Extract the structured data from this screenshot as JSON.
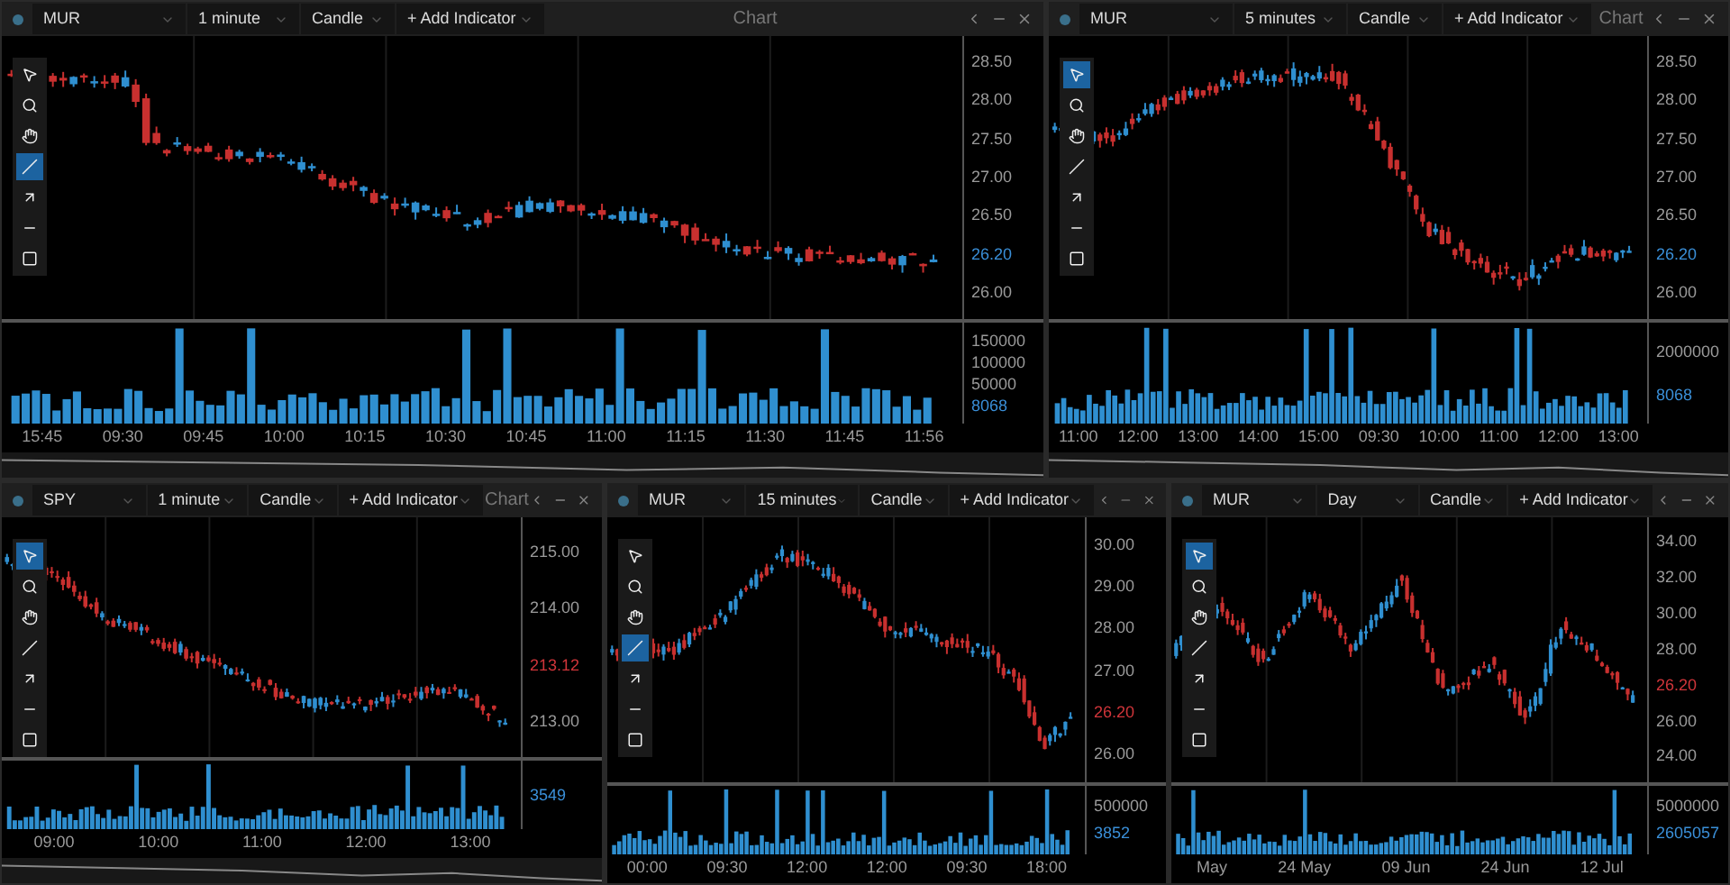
{
  "panels": [
    {
      "symbol": "MUR",
      "interval": "1 minute",
      "chart_type": "Candle",
      "add_indicator": "+ Add Indicator",
      "title": "Chart",
      "tools": [
        {
          "kind": "pointer",
          "selected": false
        },
        {
          "kind": "zoom",
          "selected": false
        },
        {
          "kind": "pan",
          "selected": false
        },
        {
          "kind": "line",
          "selected": true
        },
        {
          "kind": "arrow",
          "selected": false
        },
        {
          "kind": "hline",
          "selected": false
        },
        {
          "kind": "rect",
          "selected": false
        }
      ],
      "price_labels": [
        {
          "kind": "tick",
          "text": "28.50"
        },
        {
          "kind": "tick",
          "text": "28.00"
        },
        {
          "kind": "tick",
          "text": "27.50"
        },
        {
          "kind": "tick",
          "text": "27.00"
        },
        {
          "kind": "tick",
          "text": "26.50"
        },
        {
          "kind": "last",
          "text": "26.20",
          "color": "#3a8fd8"
        },
        {
          "kind": "tick",
          "text": "26.00"
        }
      ],
      "volume_labels": [
        {
          "kind": "tick",
          "text": "150000"
        },
        {
          "kind": "tick",
          "text": "100000"
        },
        {
          "kind": "tick",
          "text": "50000"
        },
        {
          "kind": "last",
          "text": "8068",
          "color": "#3a8fd8"
        }
      ],
      "time_labels": [
        "15:45",
        "09:30",
        "09:45",
        "10:00",
        "10:15",
        "10:30",
        "10:45",
        "11:00",
        "11:15",
        "11:30",
        "11:45",
        "11:56"
      ],
      "navigator": true
    },
    {
      "symbol": "MUR",
      "interval": "5 minutes",
      "chart_type": "Candle",
      "add_indicator": "+ Add Indicator",
      "title": "Chart",
      "tools": [
        {
          "kind": "pointer",
          "selected": true
        },
        {
          "kind": "zoom",
          "selected": false
        },
        {
          "kind": "pan",
          "selected": false
        },
        {
          "kind": "line",
          "selected": false
        },
        {
          "kind": "arrow",
          "selected": false
        },
        {
          "kind": "hline",
          "selected": false
        },
        {
          "kind": "rect",
          "selected": false
        }
      ],
      "price_labels": [
        {
          "kind": "tick",
          "text": "28.50"
        },
        {
          "kind": "tick",
          "text": "28.00"
        },
        {
          "kind": "tick",
          "text": "27.50"
        },
        {
          "kind": "tick",
          "text": "27.00"
        },
        {
          "kind": "tick",
          "text": "26.50"
        },
        {
          "kind": "last",
          "text": "26.20",
          "color": "#3a8fd8"
        },
        {
          "kind": "tick",
          "text": "26.00"
        }
      ],
      "volume_labels": [
        {
          "kind": "tick",
          "text": "2000000"
        },
        {
          "kind": "last",
          "text": "8068",
          "color": "#3a8fd8"
        }
      ],
      "time_labels": [
        "11:00",
        "12:00",
        "13:00",
        "14:00",
        "15:00",
        "09:30",
        "10:00",
        "11:00",
        "12:00",
        "13:00"
      ],
      "navigator": true
    },
    {
      "symbol": "SPY",
      "interval": "1 minute",
      "chart_type": "Candle",
      "add_indicator": "+ Add Indicator",
      "title": "Chart",
      "tools": [
        {
          "kind": "pointer",
          "selected": true
        },
        {
          "kind": "zoom",
          "selected": false
        },
        {
          "kind": "pan",
          "selected": false
        },
        {
          "kind": "line",
          "selected": false
        },
        {
          "kind": "arrow",
          "selected": false
        },
        {
          "kind": "hline",
          "selected": false
        },
        {
          "kind": "rect",
          "selected": false
        }
      ],
      "price_labels": [
        {
          "kind": "tick",
          "text": "215.00"
        },
        {
          "kind": "tick",
          "text": "214.00"
        },
        {
          "kind": "last",
          "text": "213.12",
          "color": "#d0353a"
        },
        {
          "kind": "tick",
          "text": "213.00"
        }
      ],
      "volume_labels": [
        {
          "kind": "last",
          "text": "3549",
          "color": "#3a8fd8"
        }
      ],
      "time_labels": [
        "09:00",
        "10:00",
        "11:00",
        "12:00",
        "13:00"
      ],
      "navigator": true
    },
    {
      "symbol": "MUR",
      "interval": "15 minutes",
      "chart_type": "Candle",
      "add_indicator": "+ Add Indicator",
      "tools": [
        {
          "kind": "pointer",
          "selected": false
        },
        {
          "kind": "zoom",
          "selected": false
        },
        {
          "kind": "pan",
          "selected": false
        },
        {
          "kind": "line",
          "selected": true
        },
        {
          "kind": "arrow",
          "selected": false
        },
        {
          "kind": "hline",
          "selected": false
        },
        {
          "kind": "rect",
          "selected": false
        }
      ],
      "price_labels": [
        {
          "kind": "tick",
          "text": "30.00"
        },
        {
          "kind": "tick",
          "text": "29.00"
        },
        {
          "kind": "tick",
          "text": "28.00"
        },
        {
          "kind": "tick",
          "text": "27.00"
        },
        {
          "kind": "last",
          "text": "26.20",
          "color": "#d0353a"
        },
        {
          "kind": "tick",
          "text": "26.00"
        }
      ],
      "volume_labels": [
        {
          "kind": "tick",
          "text": "500000"
        },
        {
          "kind": "last",
          "text": "3852",
          "color": "#3a8fd8"
        }
      ],
      "time_labels": [
        "00:00",
        "09:30",
        "12:00",
        "12:00",
        "09:30",
        "18:00"
      ],
      "navigator": false
    },
    {
      "symbol": "MUR",
      "interval": "Day",
      "chart_type": "Candle",
      "add_indicator": "+ Add Indicator",
      "tools": [
        {
          "kind": "pointer",
          "selected": true
        },
        {
          "kind": "zoom",
          "selected": false
        },
        {
          "kind": "pan",
          "selected": false
        },
        {
          "kind": "line",
          "selected": false
        },
        {
          "kind": "arrow",
          "selected": false
        },
        {
          "kind": "hline",
          "selected": false
        },
        {
          "kind": "rect",
          "selected": false
        }
      ],
      "price_labels": [
        {
          "kind": "tick",
          "text": "34.00"
        },
        {
          "kind": "tick",
          "text": "32.00"
        },
        {
          "kind": "tick",
          "text": "30.00"
        },
        {
          "kind": "tick",
          "text": "28.00"
        },
        {
          "kind": "last",
          "text": "26.20",
          "color": "#d0353a"
        },
        {
          "kind": "tick",
          "text": "26.00"
        },
        {
          "kind": "tick",
          "text": "24.00"
        }
      ],
      "volume_labels": [
        {
          "kind": "tick",
          "text": "5000000"
        },
        {
          "kind": "last",
          "text": "2605057",
          "color": "#3a8fd8"
        }
      ],
      "time_labels": [
        "May",
        "24 May",
        "09 Jun",
        "24 Jun",
        "12 Jul"
      ],
      "navigator": false
    }
  ]
}
